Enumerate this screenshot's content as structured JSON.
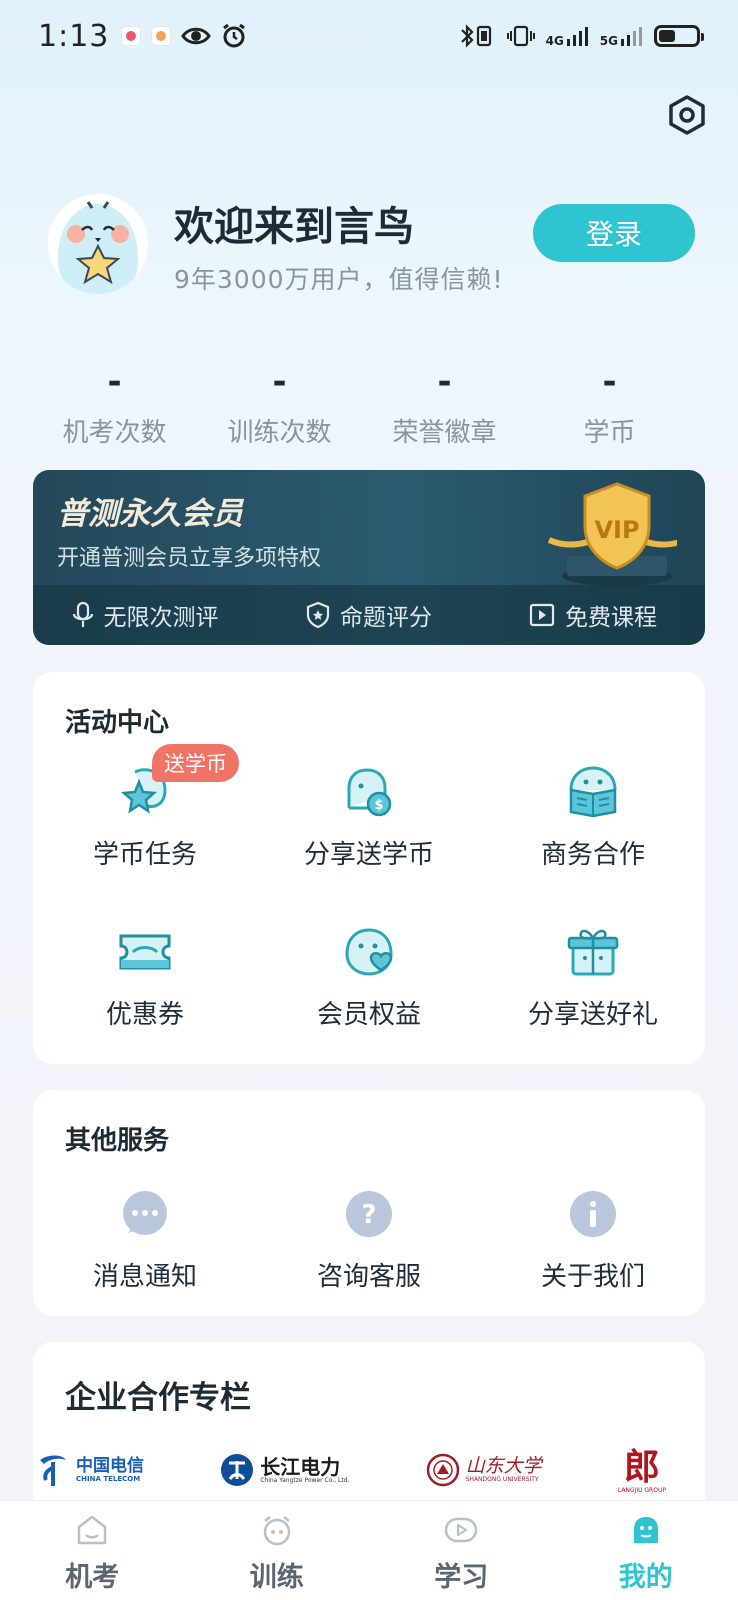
{
  "status_bar": {
    "time": "1:13",
    "network_1": "4G",
    "network_2": "5G"
  },
  "profile": {
    "welcome": "欢迎来到言鸟",
    "subtitle": "9年3000万用户，值得信赖!",
    "login_label": "登录"
  },
  "stats": [
    {
      "value": "-",
      "label": "机考次数"
    },
    {
      "value": "-",
      "label": "训练次数"
    },
    {
      "value": "-",
      "label": "荣誉徽章"
    },
    {
      "value": "-",
      "label": "学币"
    }
  ],
  "vip": {
    "title": "普测永久会员",
    "subtitle": "开通普测会员立享多项特权",
    "badge_text": "VIP",
    "features": [
      {
        "label": "无限次测评",
        "icon": "microphone-icon"
      },
      {
        "label": "命题评分",
        "icon": "shield-star-icon"
      },
      {
        "label": "免费课程",
        "icon": "play-icon"
      }
    ]
  },
  "activity": {
    "title": "活动中心",
    "tag": "送学币",
    "items": [
      {
        "label": "学币任务",
        "icon": "star-task-icon"
      },
      {
        "label": "分享送学币",
        "icon": "coin-share-icon"
      },
      {
        "label": "商务合作",
        "icon": "book-icon"
      },
      {
        "label": "优惠券",
        "icon": "coupon-icon"
      },
      {
        "label": "会员权益",
        "icon": "member-heart-icon"
      },
      {
        "label": "分享送好礼",
        "icon": "gift-icon"
      }
    ]
  },
  "services": {
    "title": "其他服务",
    "items": [
      {
        "label": "消息通知",
        "icon": "message-icon"
      },
      {
        "label": "咨询客服",
        "icon": "question-icon"
      },
      {
        "label": "关于我们",
        "icon": "info-icon"
      }
    ]
  },
  "partners": {
    "title": "企业合作专栏",
    "items": [
      {
        "name": "中国电信",
        "sub": "CHINA TELECOM"
      },
      {
        "name": "长江电力",
        "sub": "China Yangtze Power Co., Ltd."
      },
      {
        "name": "山东大学",
        "sub": "SHANDONG UNIVERSITY"
      },
      {
        "name": "郎",
        "sub": "LANGJIU GROUP"
      }
    ]
  },
  "tabbar": [
    {
      "label": "机考",
      "icon": "home-icon"
    },
    {
      "label": "训练",
      "icon": "alarm-icon"
    },
    {
      "label": "学习",
      "icon": "video-icon"
    },
    {
      "label": "我的",
      "icon": "profile-icon",
      "active": true
    }
  ],
  "colors": {
    "accent": "#2ec4d0",
    "tag": "#f07466",
    "vip_bg": "#23485a"
  }
}
